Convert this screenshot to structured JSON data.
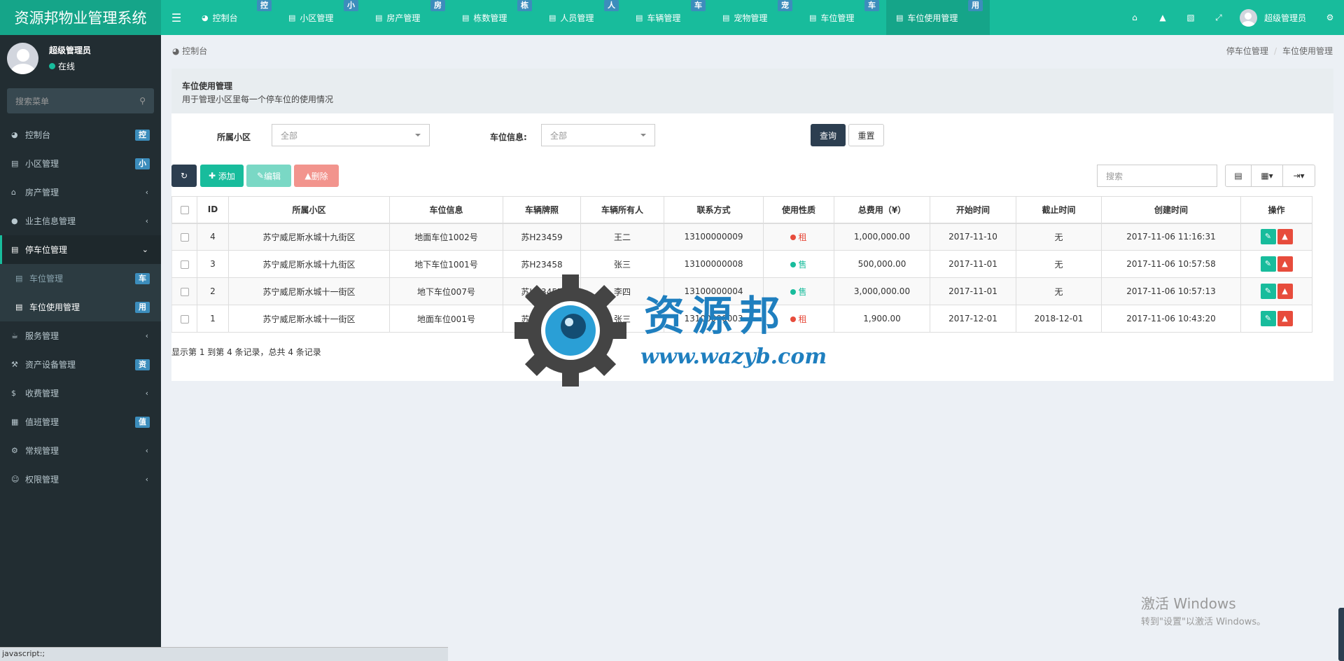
{
  "header": {
    "brand": "资源邦物业管理系统",
    "tabs": [
      {
        "label": "控制台",
        "badge": "控",
        "icon": "dashboard-icon"
      },
      {
        "label": "小区管理",
        "badge": "小",
        "icon": "list-icon"
      },
      {
        "label": "房产管理",
        "badge": "房",
        "icon": "list-icon"
      },
      {
        "label": "栋数管理",
        "badge": "栋",
        "icon": "list-icon"
      },
      {
        "label": "人员管理",
        "badge": "人",
        "icon": "list-icon"
      },
      {
        "label": "车辆管理",
        "badge": "车",
        "icon": "list-icon"
      },
      {
        "label": "宠物管理",
        "badge": "宠",
        "icon": "list-icon"
      },
      {
        "label": "车位管理",
        "badge": "车",
        "icon": "list-icon"
      },
      {
        "label": "车位使用管理",
        "badge": "用",
        "icon": "list-icon"
      }
    ],
    "user_name": "超级管理员"
  },
  "sidebar": {
    "user_name": "超级管理员",
    "status": "在线",
    "search_placeholder": "搜索菜单",
    "items": [
      {
        "label": "控制台",
        "badge": "控"
      },
      {
        "label": "小区管理",
        "badge": "小"
      },
      {
        "label": "房产管理"
      },
      {
        "label": "业主信息管理"
      },
      {
        "label": "停车位管理"
      },
      {
        "label": "车位管理",
        "badge": "车"
      },
      {
        "label": "车位使用管理",
        "badge": "用"
      },
      {
        "label": "服务管理"
      },
      {
        "label": "资产设备管理",
        "badge": "资"
      },
      {
        "label": "收费管理"
      },
      {
        "label": "值班管理",
        "badge": "值"
      },
      {
        "label": "常规管理"
      },
      {
        "label": "权限管理"
      }
    ]
  },
  "breadcrumb": {
    "left": "控制台",
    "right": [
      "停车位管理",
      "车位使用管理"
    ]
  },
  "panel": {
    "title": "车位使用管理",
    "desc": "用于管理小区里每一个停车位的使用情况"
  },
  "filter": {
    "community_label": "所属小区",
    "community_value": "全部",
    "space_label": "车位信息:",
    "space_value": "全部",
    "query": "查询",
    "reset": "重置"
  },
  "toolbar": {
    "add": "添加",
    "edit": "编辑",
    "delete": "删除",
    "search_placeholder": "搜索"
  },
  "table": {
    "headers": [
      "ID",
      "所属小区",
      "车位信息",
      "车辆牌照",
      "车辆所有人",
      "联系方式",
      "使用性质",
      "总费用（¥）",
      "开始时间",
      "截止时间",
      "创建时间",
      "操作"
    ],
    "rows": [
      {
        "id": "4",
        "community": "苏宁威尼斯水城十九街区",
        "space": "地面车位1002号",
        "plate": "苏H23459",
        "owner": "王二",
        "phone": "13100000009",
        "use": "租",
        "use_color": "#e74c3c",
        "fee": "1,000,000.00",
        "start": "2017-11-10",
        "end": "无",
        "created": "2017-11-06 11:16:31"
      },
      {
        "id": "3",
        "community": "苏宁威尼斯水城十九街区",
        "space": "地下车位1001号",
        "plate": "苏H23458",
        "owner": "张三",
        "phone": "13100000008",
        "use": "售",
        "use_color": "#18bc9c",
        "fee": "500,000.00",
        "start": "2017-11-01",
        "end": "无",
        "created": "2017-11-06 10:57:58"
      },
      {
        "id": "2",
        "community": "苏宁威尼斯水城十一街区",
        "space": "地下车位007号",
        "plate": "苏H23457",
        "owner": "李四",
        "phone": "13100000004",
        "use": "售",
        "use_color": "#18bc9c",
        "fee": "3,000,000.00",
        "start": "2017-11-01",
        "end": "无",
        "created": "2017-11-06 10:57:13"
      },
      {
        "id": "1",
        "community": "苏宁威尼斯水城十一街区",
        "space": "地面车位001号",
        "plate": "苏H23456",
        "owner": "张三",
        "phone": "13100000003",
        "use": "租",
        "use_color": "#e74c3c",
        "fee": "1,900.00",
        "start": "2017-12-01",
        "end": "2018-12-01",
        "created": "2017-11-06 10:43:20"
      }
    ]
  },
  "summary": "显示第 1 到第 4 条记录，总共 4 条记录",
  "watermark": {
    "name": "资源邦",
    "url": "www.wazyb.com"
  },
  "windows": {
    "line1": "激活 Windows",
    "line2": "转到\"设置\"以激活 Windows。"
  },
  "statusbar": "javascript:;"
}
